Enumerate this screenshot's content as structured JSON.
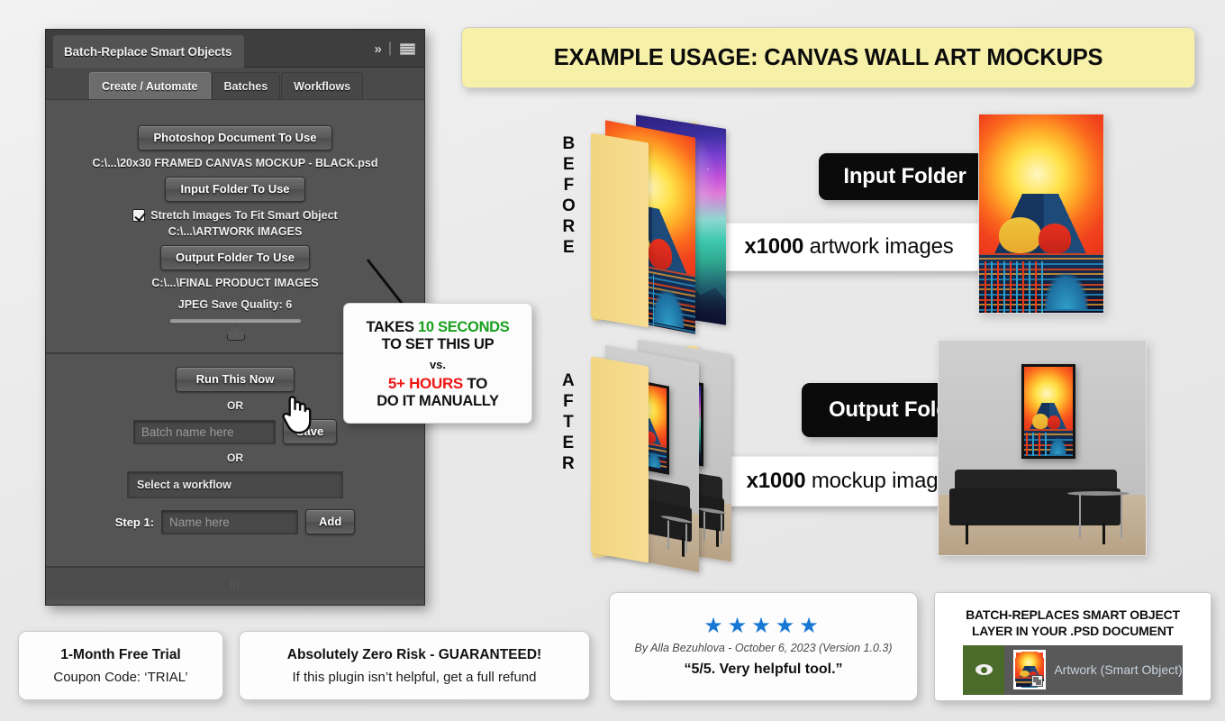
{
  "banner": {
    "title": "EXAMPLE USAGE: CANVAS WALL ART MOCKUPS"
  },
  "panel": {
    "title": "Batch-Replace Smart Objects",
    "icons": {
      "collapse": "chevron-double-right-icon",
      "menu": "hamburger-menu-icon"
    },
    "tabs": [
      {
        "label": "Create / Automate",
        "active": true
      },
      {
        "label": "Batches",
        "active": false
      },
      {
        "label": "Workflows",
        "active": false
      }
    ],
    "psd_button": "Photoshop Document To Use",
    "psd_path": "C:\\...\\20x30 FRAMED CANVAS MOCKUP - BLACK.psd",
    "input_button": "Input Folder To Use",
    "stretch_checkbox_label": "Stretch Images To Fit Smart Object",
    "stretch_checked": true,
    "input_path": "C:\\...\\ARTWORK IMAGES",
    "output_button": "Output Folder To Use",
    "output_path": "C:\\...\\FINAL PRODUCT IMAGES",
    "quality_label": "JPEG Save Quality: 6",
    "quality_value": 6,
    "run_button": "Run This Now",
    "or_1": "OR",
    "batch_name_placeholder": "Batch name here",
    "save_button": "Save",
    "or_2": "OR",
    "workflow_select": "Select a workflow",
    "step_label": "Step 1:",
    "step_name_placeholder": "Name here",
    "add_button": "Add"
  },
  "callout": {
    "line1_a": "TAKES ",
    "line1_b": "10 SECONDS",
    "line2": "TO SET THIS UP",
    "line3": "vs.",
    "line4_a": "5+ HOURS",
    "line4_b": " TO",
    "line5": "DO IT MANUALLY",
    "green": "#19a01f",
    "red": "#f01414"
  },
  "before": {
    "word": "BEFORE",
    "pill_black": "Input Folder",
    "pill_white_bold": "x1000",
    "pill_white_rest": " artwork images"
  },
  "after": {
    "word": "AFTER",
    "pill_black": "Output Folder",
    "pill_white_bold": "x1000",
    "pill_white_rest": " mockup images"
  },
  "cards": {
    "trial": {
      "title": "1-Month Free Trial",
      "sub": "Coupon Code: ‘TRIAL’"
    },
    "risk": {
      "title": "Absolutely Zero Risk - GUARANTEED!",
      "sub": "If this plugin isn’t helpful, get a full refund"
    },
    "review": {
      "stars": "★★★★★",
      "star_count": 5,
      "star_color": "#1878d4",
      "meta": "By Alla Bezuhlova - October 6, 2023 (Version 1.0.3)",
      "quote": "“5/5. Very helpful tool.”"
    },
    "psd": {
      "title_line1": "BATCH-REPLACES SMART OBJECT",
      "title_line2": "LAYER IN YOUR .PSD DOCUMENT",
      "eye_icon": "eye-visibility-icon",
      "layer_name": "Artwork (Smart Object)"
    }
  }
}
